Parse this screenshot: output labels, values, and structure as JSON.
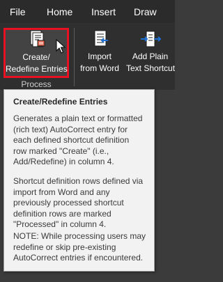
{
  "menu": {
    "items": [
      "File",
      "Home",
      "Insert",
      "Draw"
    ]
  },
  "ribbon": {
    "create_button": {
      "line1": "Create/",
      "line2": "Redefine Entries",
      "icon": "create-entries-icon"
    },
    "import_button": {
      "line1": "Import",
      "line2": "from Word",
      "icon": "import-from-word-icon"
    },
    "add_plain_button": {
      "line1": "Add Plain",
      "line2": "Text Shortcut",
      "icon": "add-plain-text-shortcut-icon"
    },
    "group_label": "Process"
  },
  "tooltip": {
    "title": "Create/Redefine Entries",
    "paragraph1": [
      "Generates a plain text or formatted",
      "(rich text) AutoCorrect entry for",
      "each defined shortcut definition",
      "row marked \"Create\" (i.e.,",
      "Add/Redefine) in column 4."
    ],
    "paragraph2": [
      "Shortcut definition rows defined via",
      "import from Word and any",
      "previously processed shortcut",
      "definition rows are marked",
      "\"Processed\" in column 4."
    ],
    "paragraph3": [
      "NOTE: While processing users may",
      "redefine or skip pre-existing",
      "AutoCorrect entries if encountered."
    ]
  },
  "colors": {
    "highlight_border": "#e81123",
    "ribbon_bg": "#2f2f2f",
    "tooltip_bg": "#f2f2f2"
  }
}
